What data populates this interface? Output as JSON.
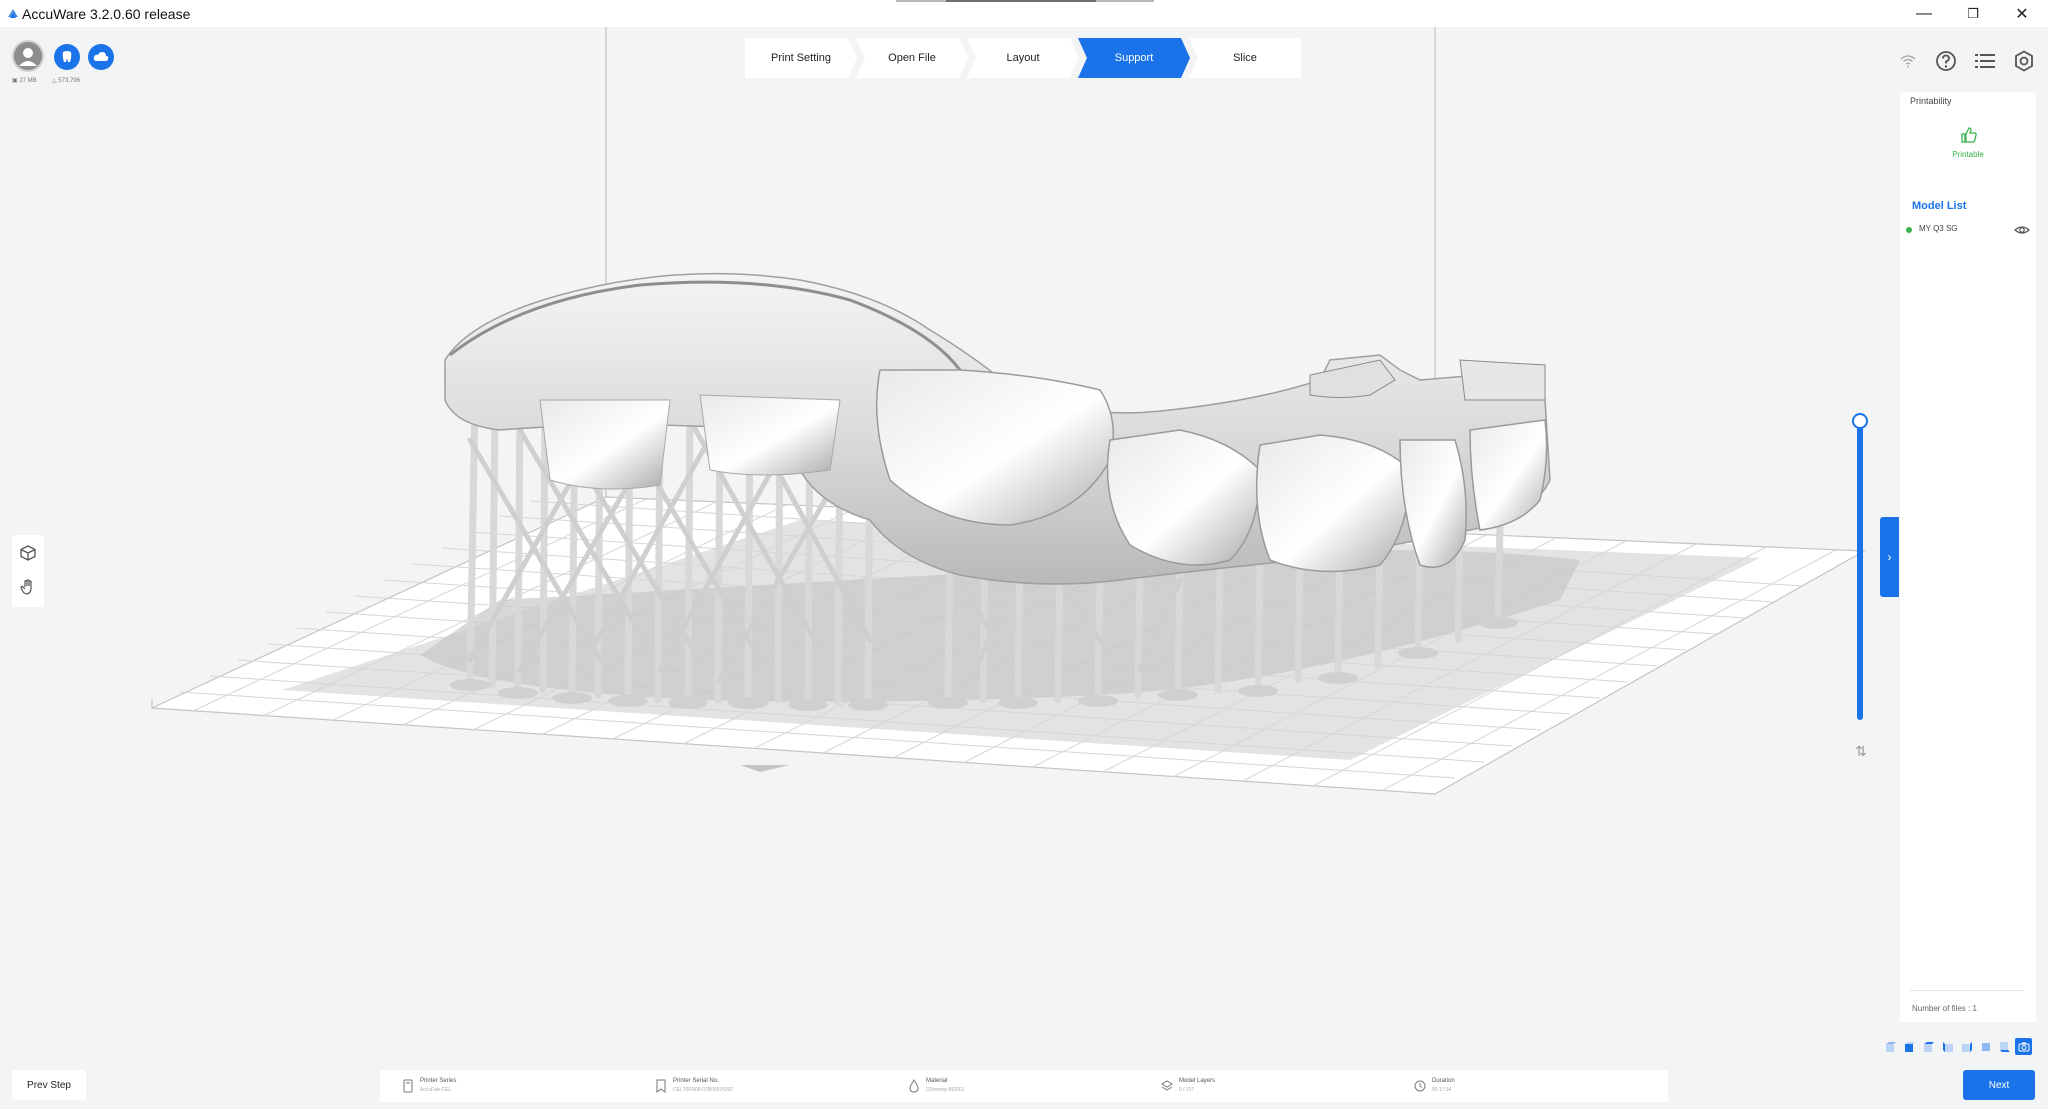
{
  "window": {
    "title": "AccuWare 3.2.0.60 release",
    "minimize_symbol": "—",
    "restore_symbol": "❐",
    "close_symbol": "✕"
  },
  "user": {
    "stat1": "27 MB",
    "stat2": "573,796"
  },
  "steps": [
    {
      "label": "Print Setting",
      "active": false
    },
    {
      "label": "Open File",
      "active": false
    },
    {
      "label": "Layout",
      "active": false
    },
    {
      "label": "Support",
      "active": true
    },
    {
      "label": "Slice",
      "active": false
    }
  ],
  "panel": {
    "collapse_symbol": "›",
    "printability_title": "Printability",
    "printable_label": "Printable",
    "model_list_title": "Model List",
    "models": [
      {
        "name": "MY Q3 SG"
      }
    ],
    "files_count": "Number of files : 1"
  },
  "slider": {
    "swap_symbol": "⇅",
    "level": 1.0
  },
  "infobar": {
    "printer_series_label": "Printer Series",
    "printer_series_value": "AccuFab-CEL",
    "serial_label": "Printer Serial No.",
    "serial_value": "CEL70FR00-02B00076007",
    "material_label": "Material",
    "material_value": "DDmmsg-BDD01",
    "layers_label": "Model Layers",
    "layers_value": "0 / 217",
    "duration_label": "Duration",
    "duration_value": "00:17:34"
  },
  "buttons": {
    "prev": "Prev Step",
    "next": "Next"
  },
  "colors": {
    "accent": "#1a73e8",
    "success": "#37b24d",
    "background": "#f3f4f6",
    "model": "#e6e6e6"
  }
}
